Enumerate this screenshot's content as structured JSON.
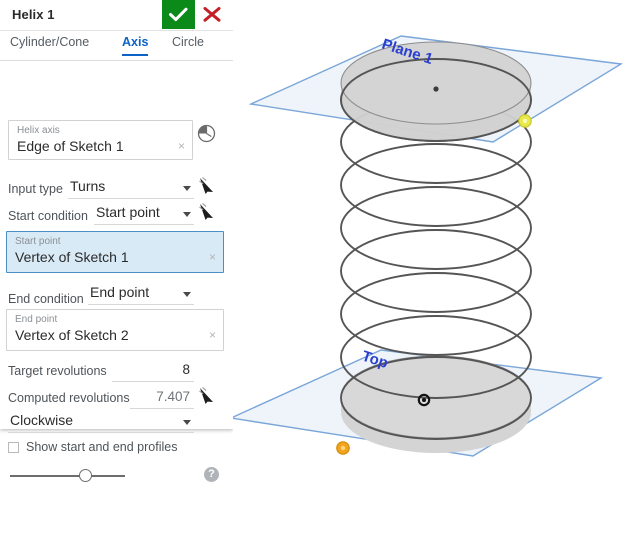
{
  "dialog": {
    "title": "Helix 1",
    "accept_label": "accept",
    "cancel_label": "cancel",
    "tabs": [
      {
        "id": "cylinder",
        "label": "Cylinder/Cone",
        "active": false
      },
      {
        "id": "axis",
        "label": "Axis",
        "active": true
      },
      {
        "id": "circle",
        "label": "Circle",
        "active": false
      }
    ],
    "helix_axis": {
      "label": "Helix axis",
      "value": "Edge of Sketch 1",
      "clear": "×"
    },
    "input_type": {
      "label": "Input type",
      "value": "Turns"
    },
    "start_condition": {
      "label": "Start condition",
      "value": "Start point"
    },
    "start_point": {
      "label": "Start point",
      "value": "Vertex of Sketch 1",
      "clear": "×",
      "selected": true
    },
    "end_condition": {
      "label": "End condition",
      "value": "End point"
    },
    "end_point": {
      "label": "End point",
      "value": "Vertex of Sketch 2",
      "clear": "×"
    },
    "target_revolutions": {
      "label": "Target revolutions",
      "value": "8"
    },
    "computed_revolutions": {
      "label": "Computed revolutions",
      "value": "7.407"
    },
    "direction": {
      "value": "Clockwise"
    },
    "show_profiles": {
      "label": "Show start and end profiles",
      "checked": false
    },
    "help": {
      "label": "?"
    }
  },
  "viewport": {
    "plane_labels": [
      {
        "id": "plane1",
        "text": "Plane 1"
      },
      {
        "id": "top",
        "text": "Top"
      }
    ],
    "colors": {
      "plane_fill": "#eef4fa",
      "plane_stroke": "#7aa6d8",
      "label_color": "#2a3fd0",
      "helix_stroke": "#555555",
      "disk_fill": "#d4d4d4",
      "start_point": "#e8e84a",
      "end_point": "#f2a51c"
    },
    "markers": [
      {
        "id": "start-point-marker",
        "color": "#e8e84a"
      },
      {
        "id": "end-point-marker",
        "color": "#f2a51c"
      },
      {
        "id": "top-center-point",
        "color": "#444444"
      },
      {
        "id": "bottom-origin-point",
        "color": "#111111"
      }
    ],
    "helix": {
      "turns": 7.407,
      "direction": "Clockwise"
    }
  }
}
